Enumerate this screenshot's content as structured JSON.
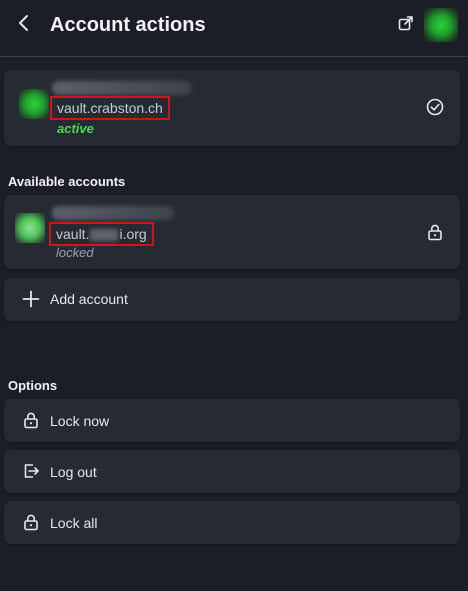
{
  "header": {
    "title": "Account actions",
    "back_icon": "chevron-left-icon",
    "popout_icon": "popout-icon"
  },
  "active_account": {
    "server": "vault.crabston.ch",
    "status": "active",
    "status_icon": "check-circle-icon"
  },
  "available": {
    "section_title": "Available accounts",
    "accounts": [
      {
        "server_prefix": "vault.",
        "server_suffix": "i.org",
        "status": "locked",
        "status_icon": "lock-icon"
      }
    ],
    "add_label": "Add account"
  },
  "options": {
    "section_title": "Options",
    "items": [
      {
        "label": "Lock now",
        "icon": "lock-icon"
      },
      {
        "label": "Log out",
        "icon": "logout-icon"
      },
      {
        "label": "Lock all",
        "icon": "lock-icon"
      }
    ]
  },
  "colors": {
    "background": "#1b1e26",
    "card": "#262a33",
    "active_status": "#4ad94f",
    "redaction_box": "#d2141b"
  }
}
